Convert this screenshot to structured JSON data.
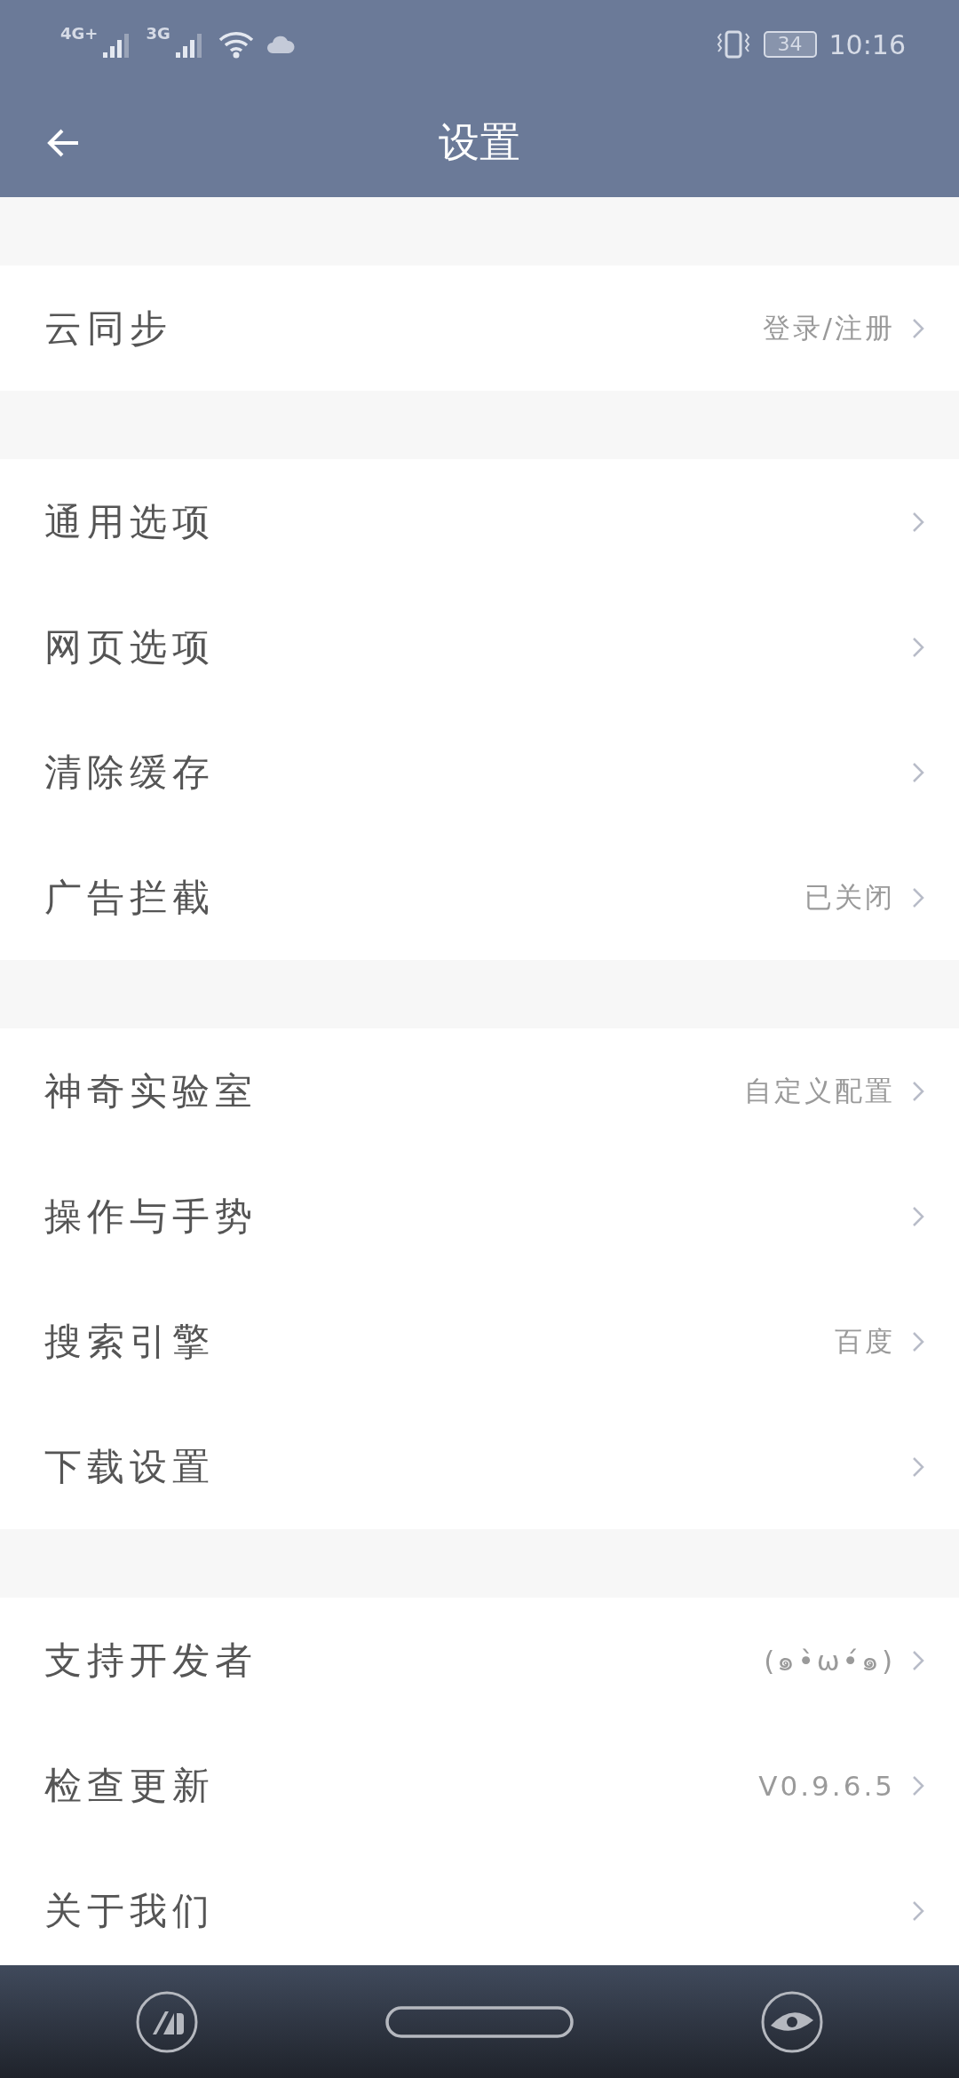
{
  "status_bar": {
    "network_1": "4G+",
    "network_2": "3G",
    "battery": "34",
    "time": "10:16"
  },
  "app_bar": {
    "title": "设置"
  },
  "groups": [
    {
      "items": [
        {
          "label": "云同步",
          "value": "登录/注册"
        }
      ]
    },
    {
      "items": [
        {
          "label": "通用选项"
        },
        {
          "label": "网页选项"
        },
        {
          "label": "清除缓存"
        },
        {
          "label": "广告拦截",
          "value": "已关闭"
        }
      ]
    },
    {
      "items": [
        {
          "label": "神奇实验室",
          "value": "自定义配置"
        },
        {
          "label": "操作与手势"
        },
        {
          "label": "搜索引擎",
          "value": "百度"
        },
        {
          "label": "下载设置"
        }
      ]
    },
    {
      "items": [
        {
          "label": "支持开发者",
          "value": "(๑•̀ω•́๑)"
        },
        {
          "label": "检查更新",
          "value": "V0.9.6.5"
        },
        {
          "label": "关于我们"
        }
      ]
    }
  ]
}
